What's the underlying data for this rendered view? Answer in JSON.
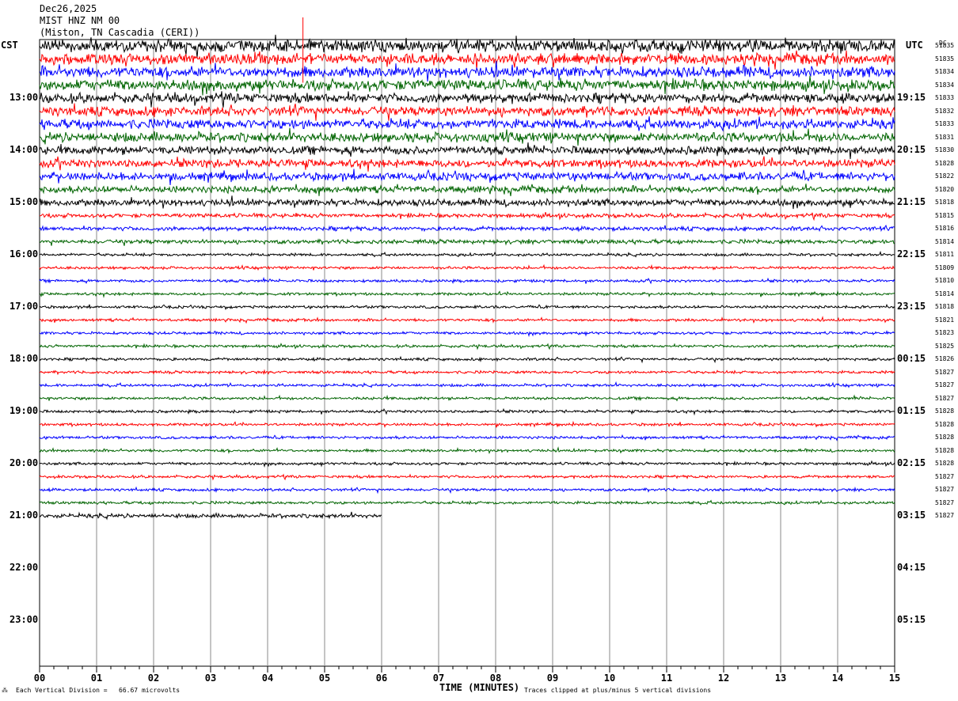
{
  "header": {
    "date": "Dec26,2025",
    "station": "MIST HNZ NM 00",
    "location": "(Miston, TN Cascadia (CERI))"
  },
  "timezones": {
    "left": "CST",
    "right": "UTC",
    "dc": "DC"
  },
  "chart_data": {
    "type": "line",
    "title": "MIST HNZ NM 00",
    "xlabel": "TIME (MINUTES)",
    "xlim": [
      0,
      15
    ],
    "x_ticks": [
      "00",
      "01",
      "02",
      "03",
      "04",
      "05",
      "06",
      "07",
      "08",
      "09",
      "10",
      "11",
      "12",
      "13",
      "14",
      "15"
    ],
    "row_count": 48,
    "rows_per_hour": 4,
    "trace_colors": [
      "#000000",
      "#ff0000",
      "#0000ff",
      "#006400"
    ],
    "left_hour_labels": [
      "13:00",
      "14:00",
      "15:00",
      "16:00",
      "17:00",
      "18:00",
      "19:00",
      "20:00",
      "21:00",
      "22:00",
      "23:00"
    ],
    "right_hour_labels": [
      "19:15",
      "20:15",
      "21:15",
      "22:15",
      "23:15",
      "00:15",
      "01:15",
      "02:15",
      "03:15",
      "04:15",
      "05:15"
    ],
    "dc_offsets": [
      "51835",
      "51835",
      "51834",
      "51834",
      "51833",
      "51832",
      "51833",
      "51831",
      "51830",
      "51828",
      "51822",
      "51820",
      "51818",
      "51815",
      "51816",
      "51814",
      "51811",
      "51809",
      "51810",
      "51814",
      "51818",
      "51821",
      "51823",
      "51825",
      "51826",
      "51827",
      "51827",
      "51827",
      "51828",
      "51828",
      "51828",
      "51828",
      "51828",
      "51827",
      "51827",
      "51827",
      "51827"
    ],
    "trace_amplitude": [
      9,
      8,
      8,
      8,
      7,
      7,
      7,
      7,
      6,
      6,
      6,
      5,
      5,
      3,
      3,
      3,
      2,
      2,
      2,
      2,
      2,
      2,
      2,
      2,
      2,
      2,
      2,
      2,
      2,
      2,
      2,
      2,
      2,
      2,
      2,
      2,
      3
    ],
    "last_trace_minutes": 6.0,
    "event_spike_minute": 4.62
  },
  "footer": {
    "scale": "Each Vertical Division =   66.67 microvolts",
    "clip": "Traces clipped at plus/minus 5 vertical divisions"
  }
}
